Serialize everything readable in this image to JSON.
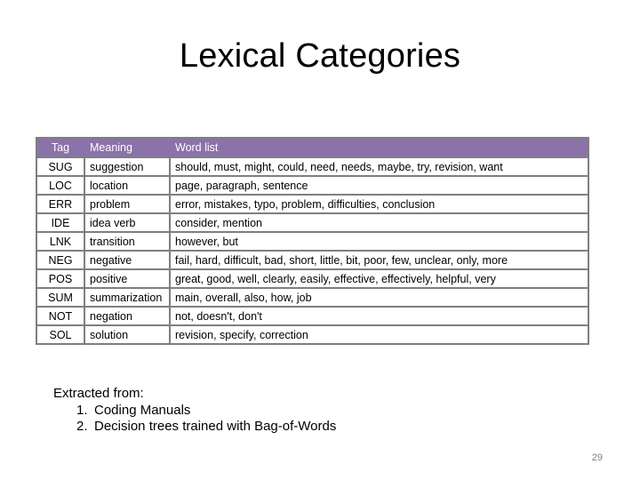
{
  "slide": {
    "title": "Lexical Categories",
    "page_number": "29"
  },
  "table": {
    "header_color": "#8b72aa",
    "border_color": "#7f7f7f",
    "columns": [
      "Tag",
      "Meaning",
      "Word list"
    ],
    "rows": [
      {
        "tag": "SUG",
        "meaning": "suggestion",
        "words": "should, must, might, could, need, needs, maybe, try, revision, want"
      },
      {
        "tag": "LOC",
        "meaning": "location",
        "words": "page, paragraph, sentence"
      },
      {
        "tag": "ERR",
        "meaning": "problem",
        "words": "error, mistakes, typo, problem, difficulties, conclusion"
      },
      {
        "tag": "IDE",
        "meaning": "idea verb",
        "words": "consider, mention"
      },
      {
        "tag": "LNK",
        "meaning": "transition",
        "words": "however, but"
      },
      {
        "tag": "NEG",
        "meaning": "negative",
        "words": "fail, hard, difficult, bad, short, little, bit, poor, few, unclear, only, more"
      },
      {
        "tag": "POS",
        "meaning": "positive",
        "words": "great, good, well, clearly, easily, effective, effectively, helpful, very"
      },
      {
        "tag": "SUM",
        "meaning": "summarization",
        "words": "main, overall, also, how, job"
      },
      {
        "tag": "NOT",
        "meaning": "negation",
        "words": "not, doesn't, don't"
      },
      {
        "tag": "SOL",
        "meaning": "solution",
        "words": "revision, specify, correction"
      }
    ]
  },
  "source": {
    "heading": "Extracted from:",
    "items": [
      {
        "num": "1.",
        "text": "Coding Manuals"
      },
      {
        "num": "2.",
        "text": "Decision trees trained with Bag-of-Words"
      }
    ]
  }
}
